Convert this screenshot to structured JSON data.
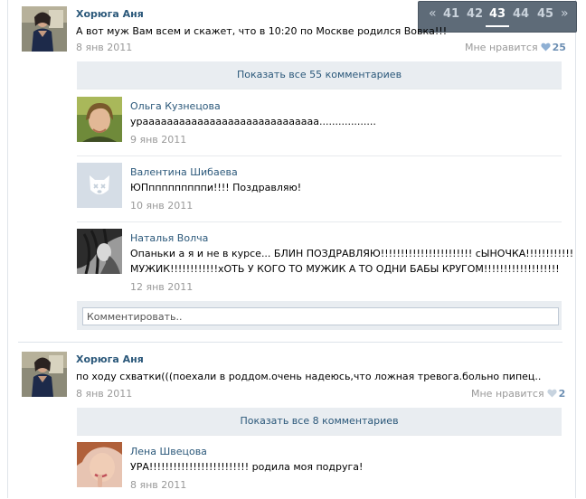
{
  "pager": {
    "prev": "«",
    "next": "»",
    "pages": [
      "41",
      "42",
      "43",
      "44",
      "45"
    ],
    "current": "43"
  },
  "posts": [
    {
      "author": "Хорюга Аня",
      "text": "А вот муж Вам всем и скажет, что в 10:20 по Москве родился Вовка!!!",
      "date": "8 янв 2011",
      "like_label": "Мне нравится",
      "like_count": "25",
      "show_all": "Показать все 55 комментариев",
      "comments": [
        {
          "name": "Ольга Кузнецова",
          "lines": [
            "урааааааааааааааааааааааааааааа.................."
          ],
          "date": "9 янв 2011"
        },
        {
          "name": "Валентина Шибаева",
          "lines": [
            "ЮПпппппппппи!!!! Поздравляю!"
          ],
          "date": "10 янв 2011"
        },
        {
          "name": "Наталья Волча",
          "lines": [
            "Опаньки а я и не в курсе... БЛИН ПОЗДРАВЛЯЮ!!!!!!!!!!!!!!!!!!!!!!! сЫНОЧКА!!!!!!!!!!!!",
            "МУЖИК!!!!!!!!!!!!хОТЬ У КОГО ТО МУЖИК А ТО ОДНИ БАБЫ КРУГОМ!!!!!!!!!!!!!!!!!!!"
          ],
          "date": "12 янв 2011"
        }
      ],
      "comment_placeholder": "Комментировать.."
    },
    {
      "author": "Хорюга Аня",
      "text": "по ходу схватки(((поехали в роддом.очень надеюсь,что ложная тревога.больно пипец..",
      "date": "8 янв 2011",
      "like_label": "Мне нравится",
      "like_count": "2",
      "show_all": "Показать все 8 комментариев",
      "comments": [
        {
          "name": "Лена Швецова",
          "lines": [
            "УРА!!!!!!!!!!!!!!!!!!!!!!!!! родила моя подруга!"
          ],
          "date": "8 янв 2011"
        }
      ]
    }
  ],
  "colors": {
    "link": "#2b587a",
    "muted": "#999999",
    "panel": "#e9edf1",
    "heart_liked": "#8fb0d4",
    "heart_plain": "#c7d3df",
    "pager_bg": "#5e6b78"
  },
  "icons": [
    "heart-icon",
    "deactivated-dog-icon"
  ]
}
